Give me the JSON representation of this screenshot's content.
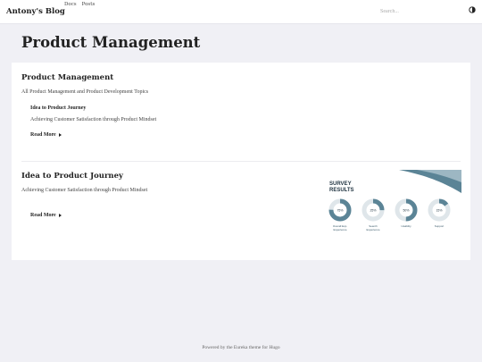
{
  "header": {
    "brand": "Antony's Blog",
    "nav": [
      {
        "label": "Docs"
      },
      {
        "label": "Posts"
      }
    ],
    "search_placeholder": "Search...",
    "theme_icon": "contrast-icon"
  },
  "page": {
    "title": "Product Management"
  },
  "sections": [
    {
      "title": "Product Management",
      "description": "All Product Management and Product Development Topics",
      "subitem": {
        "title": "Idea to Product Journey",
        "description": "Achieving Customer Satisfaction through Product Mindset"
      },
      "read_more": "Read More"
    },
    {
      "title": "Idea to Product Journey",
      "description": "Achieving Customer Satisfaction through Product Mindset",
      "read_more": "Read More",
      "thumbnail": {
        "heading_line1": "SURVEY",
        "heading_line2": "RESULTS",
        "donuts": [
          {
            "percent": 75,
            "label_line1": "Overall Exp.",
            "label_line2": "Experience"
          },
          {
            "percent": 25,
            "label_line1": "Search",
            "label_line2": "Experience"
          },
          {
            "percent": 50,
            "label_line1": "Usability",
            "label_line2": ""
          },
          {
            "percent": 15,
            "label_line1": "Support",
            "label_line2": ""
          }
        ],
        "accent_color": "#5b8496",
        "track_color": "#dfe6ea"
      }
    }
  ],
  "footer": {
    "text": "Powered by the Eureka theme for Hugo"
  }
}
